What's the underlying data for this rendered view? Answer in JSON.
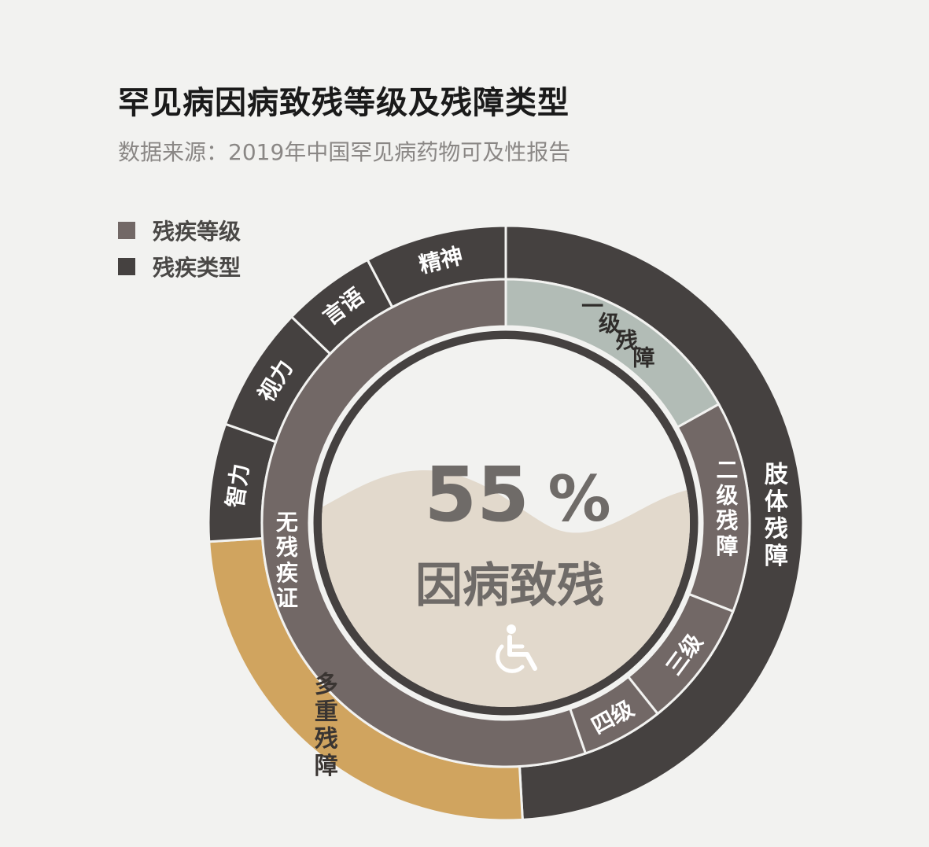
{
  "title": "罕见病因病致残等级及残障类型",
  "subtitle": "数据来源：2019年中国罕见病药物可及性报告",
  "legend": [
    {
      "label": "残疾等级",
      "color": "#726866"
    },
    {
      "label": "残疾类型",
      "color": "#454140"
    }
  ],
  "center": {
    "percent": "55",
    "percent_sign": "%",
    "label": "因病致残",
    "icon": "wheelchair-icon"
  },
  "colors": {
    "background": "#f2f2f0",
    "grade": "#726866",
    "grade_highlight": "#b2bcb6",
    "type": "#454140",
    "type_highlight": "#d0a45f",
    "wave": "#e2d9cc",
    "center_text": "#6f6b68"
  },
  "chart_data": [
    {
      "type": "donut",
      "name": "残疾等级",
      "categories": [
        "一级残障",
        "二级残障",
        "三级",
        "四级",
        "无残疾证"
      ],
      "values": [
        16.9,
        14.0,
        8.4,
        5.4,
        55.3
      ],
      "highlight": "一级残障"
    },
    {
      "type": "donut",
      "name": "残疾类型",
      "categories": [
        "肢体残障",
        "多重残障",
        "智力",
        "视力",
        "言语",
        "精神"
      ],
      "values": [
        49.1,
        24.9,
        6.4,
        6.8,
        5.1,
        7.7
      ],
      "highlight": "多重残障"
    }
  ]
}
